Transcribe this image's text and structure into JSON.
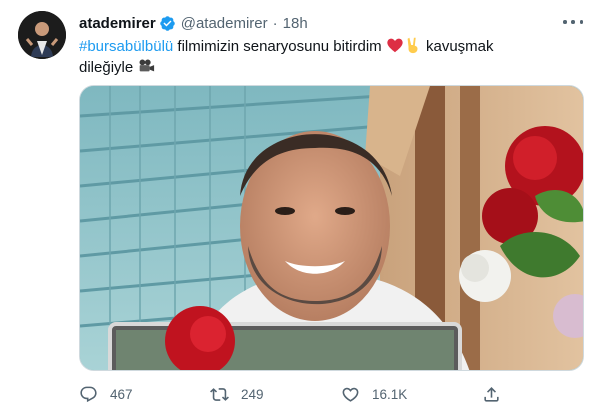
{
  "tweet": {
    "display_name": "atademirer",
    "handle": "@atademirer",
    "separator": "·",
    "time": "18h",
    "text": {
      "hashtag": "#bursabülbülü",
      "part1": " filmimizin senaryosunu bitirdim ",
      "part2": " kavuşmak",
      "part3": "dileğiyle "
    },
    "stats": {
      "replies": "467",
      "retweets": "249",
      "likes": "16.1K"
    }
  },
  "colors": {
    "accent": "#1d9bf0",
    "muted": "#536471",
    "text": "#0f1419"
  },
  "icons": [
    "verified-badge-icon",
    "more-options-icon",
    "heart-emoji-icon",
    "victory-hand-emoji-icon",
    "movie-camera-emoji-icon",
    "reply-icon",
    "retweet-icon",
    "like-icon",
    "share-icon"
  ]
}
